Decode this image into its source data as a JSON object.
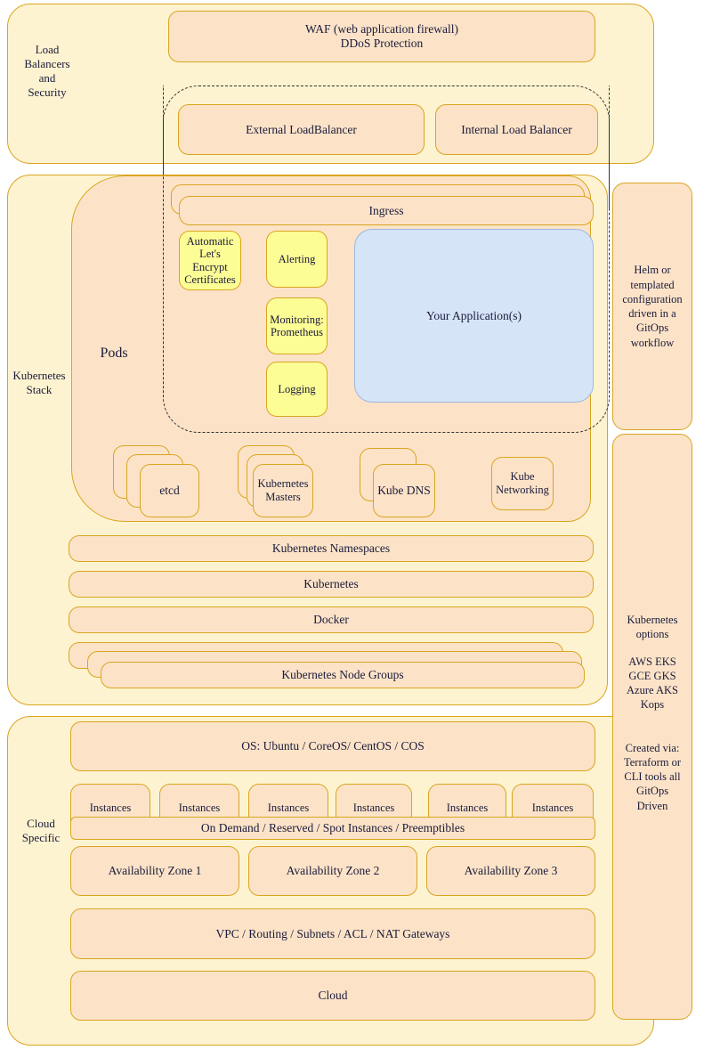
{
  "sections": {
    "load_balancers": {
      "label": "Load\nBalancers\nand\nSecurity",
      "waf": "WAF (web application firewall)\nDDoS Protection",
      "external_lb": "External LoadBalancer",
      "internal_lb": "Internal Load Balancer"
    },
    "kubernetes_stack": {
      "label": "Kubernetes\nStack",
      "pods_label": "Pods",
      "ingress": "Ingress",
      "pod_services": [
        "Automatic\nLet's\nEncrypt\nCertificates",
        "Alerting",
        "Monitoring:\nPrometheus",
        "Logging"
      ],
      "application": "Your Application(s)",
      "control_plane": [
        {
          "label": "etcd",
          "stack": 3
        },
        {
          "label": "Kubernetes\nMasters",
          "stack": 3
        },
        {
          "label": "Kube DNS",
          "stack": 2
        },
        {
          "label": "Kube\nNetworking",
          "stack": 1
        }
      ],
      "layers": [
        "Kubernetes Namespaces",
        "Kubernetes",
        "Docker"
      ],
      "node_groups": "Kubernetes Node Groups"
    },
    "cloud_specific": {
      "label": "Cloud\nSpecific",
      "os": "OS: Ubuntu / CoreOS/ CentOS / COS",
      "instances": [
        "Instances",
        "Instances",
        "Instances",
        "Instances",
        "Instances",
        "Instances"
      ],
      "pricing": "On Demand / Reserved / Spot Instances / Preemptibles",
      "zones": [
        "Availability Zone 1",
        "Availability Zone 2",
        "Availability Zone 3"
      ],
      "network": "VPC / Routing / Subnets / ACL / NAT Gateways",
      "cloud": "Cloud"
    },
    "side_panels": {
      "helm": "Helm or\ntemplated\nconfiguration\ndriven in a\nGitOps\nworkflow",
      "options_title": "Kubernetes\noptions",
      "options_list": "AWS EKS\nGCE GKS\nAzure AKS\nKops",
      "created_via": "Created via:\nTerraform or\nCLI tools all\nGitOps\nDriven"
    }
  },
  "colors": {
    "group_bg": "#FDF3D0",
    "box_bg": "#FCE3C8",
    "yellow_bg": "#FDFD96",
    "blue_bg": "#D6E4F7",
    "border": "#D9A520",
    "text": "#1A1A3A"
  }
}
